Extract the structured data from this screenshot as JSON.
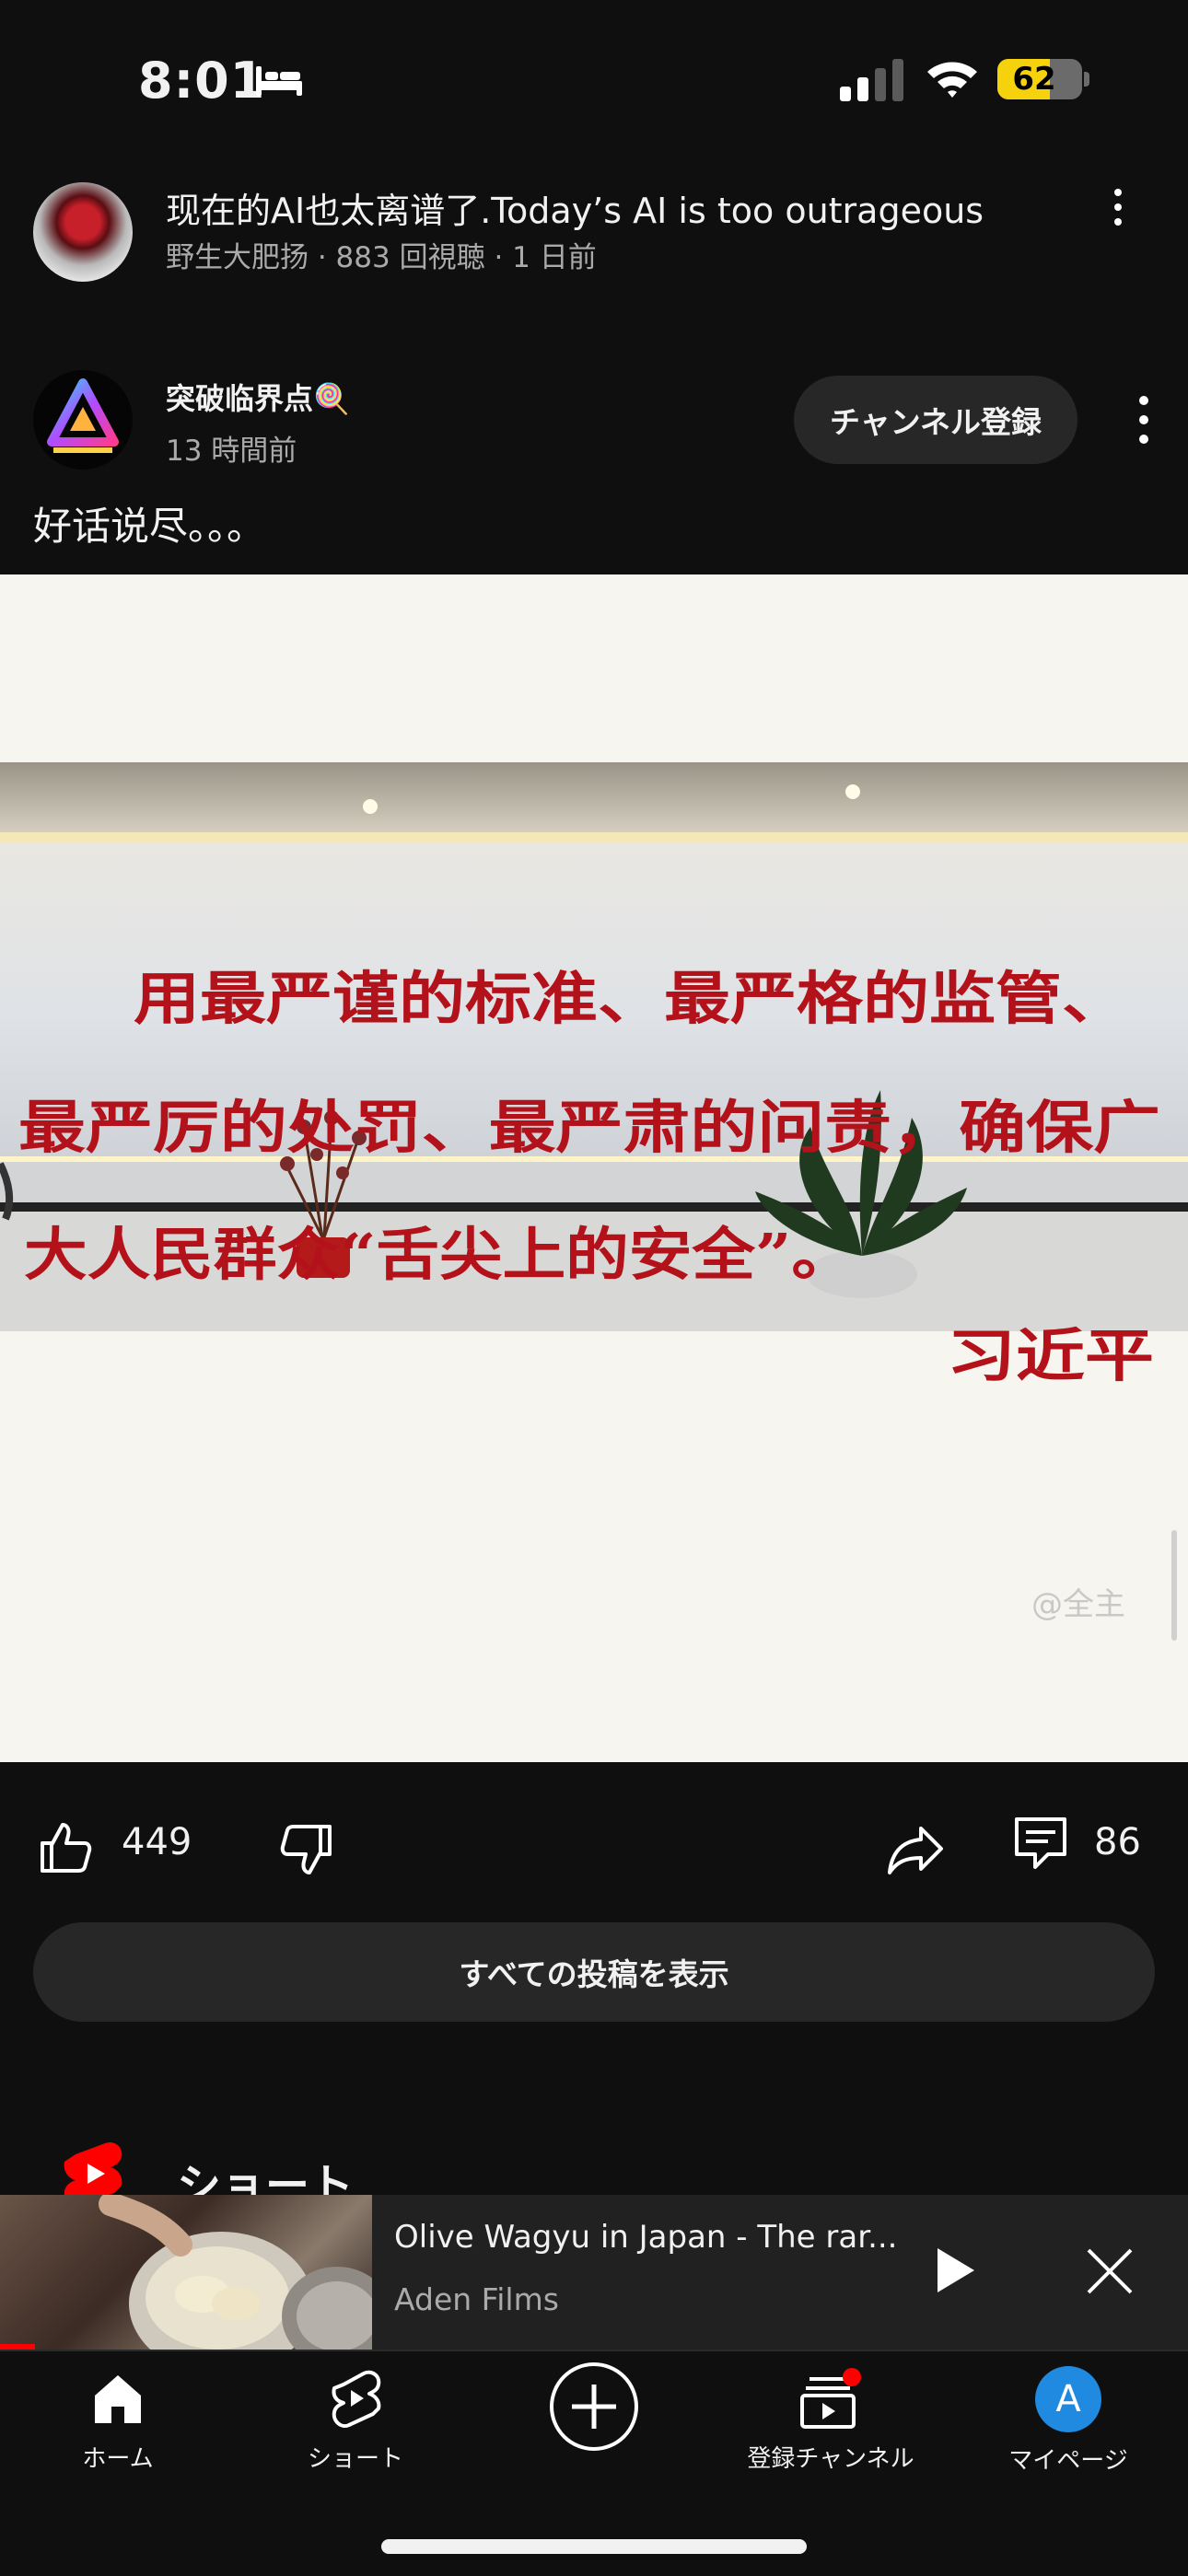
{
  "status_bar": {
    "time": "8:01",
    "battery": "62"
  },
  "video": {
    "title": "现在的AI也太离谱了.Today’s AI is too outrageous",
    "meta": "野生大肥扬 · 883 回視聴 · 1 日前"
  },
  "post": {
    "channel_name": "突破临界点🍭",
    "time": "13 時間前",
    "subscribe_label": "チャンネル登録",
    "text": "好话说尽。。。",
    "image": {
      "line1": "用最严谨的标准、最严格的监管、",
      "line2": "最严厉的处罚、最严肃的问责，确保广",
      "line3": "大人民群众“舌尖上的安全”。",
      "signature": "习近平",
      "watermark": "@全主"
    },
    "likes": "449",
    "comments": "86",
    "all_posts_label": "すべての投稿を表示"
  },
  "shorts": {
    "title": "ショート"
  },
  "mini_player": {
    "title": "Olive Wagyu in Japan - The rar...",
    "channel": "Aden Films"
  },
  "nav": {
    "home": "ホーム",
    "shorts": "ショート",
    "subscriptions": "登録チャンネル",
    "mypage": "マイページ",
    "avatar_letter": "A"
  },
  "colors": {
    "accent_red": "#ff0000",
    "battery_yellow": "#f5d20b",
    "slogan_red": "#b3121b",
    "avatar_blue": "#1f8ae0"
  }
}
